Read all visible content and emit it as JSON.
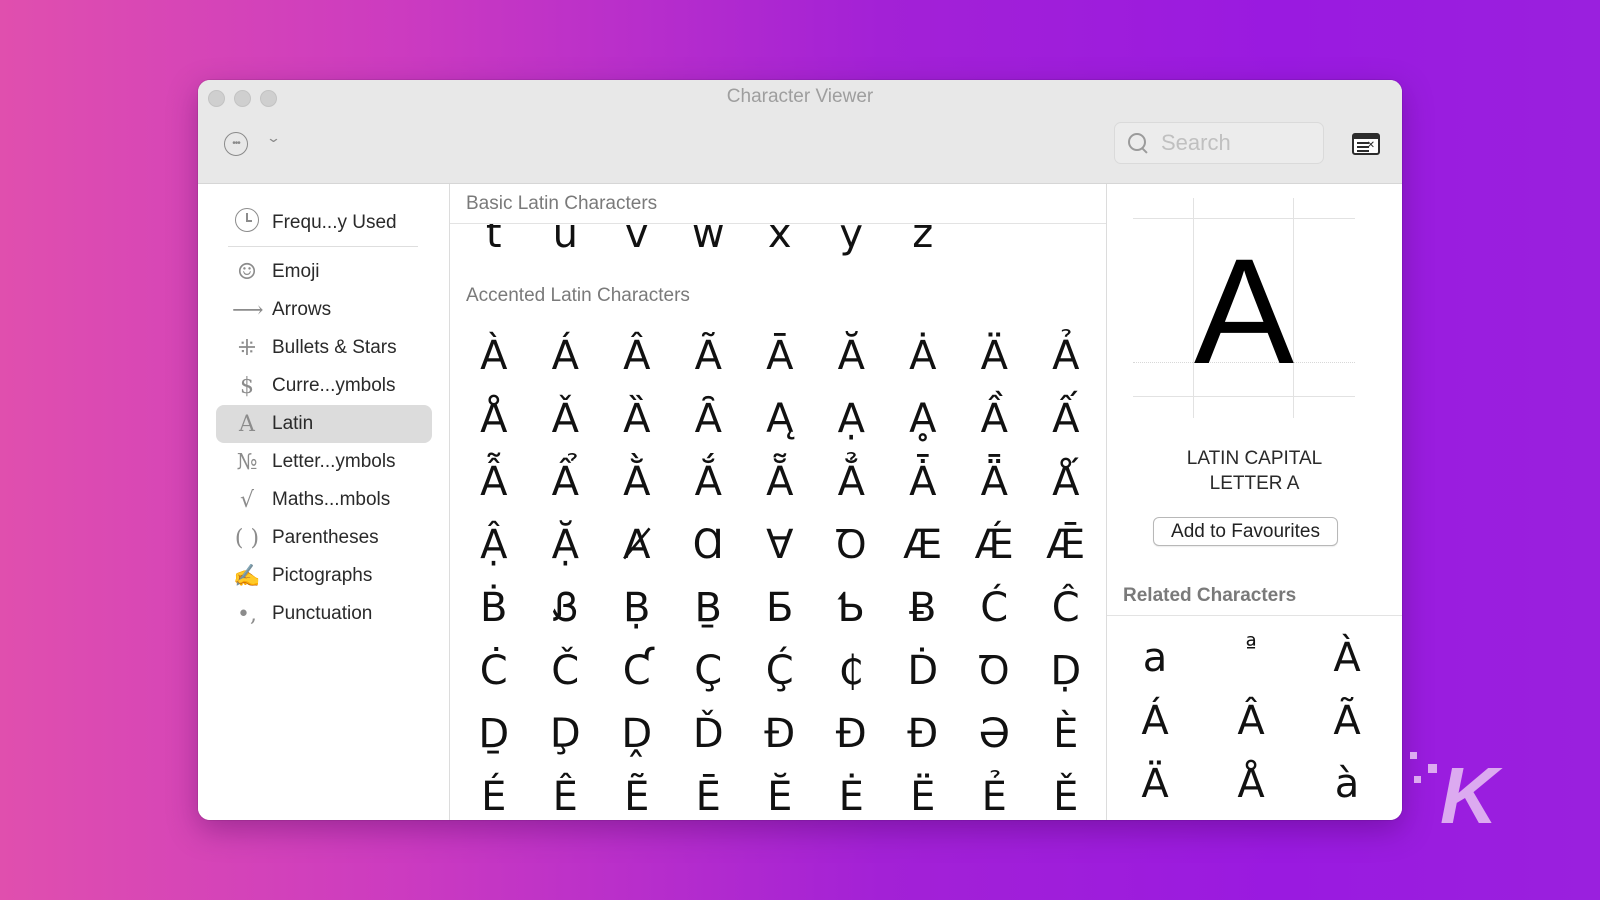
{
  "window": {
    "title": "Character Viewer",
    "traffic_lights": [
      "close",
      "minimize",
      "zoom"
    ]
  },
  "toolbar": {
    "more_icon": "ellipsis-circle-icon",
    "chevron_icon": "chevron-down-icon",
    "search_placeholder": "Search",
    "search_value": "",
    "viewer_icon": "character-viewer-window-icon"
  },
  "sidebar": {
    "items": [
      {
        "label": "Frequ...y Used",
        "icon": "clock-icon",
        "glyph": ""
      },
      {
        "label": "Emoji",
        "icon": "smiley-icon",
        "glyph": "☺"
      },
      {
        "label": "Arrows",
        "icon": "arrow-right-icon",
        "glyph": "⟶"
      },
      {
        "label": "Bullets & Stars",
        "icon": "asterisk-icon",
        "glyph": "⁜"
      },
      {
        "label": "Curre...ymbols",
        "icon": "dollar-icon",
        "glyph": "$"
      },
      {
        "label": "Latin",
        "icon": "latin-a-icon",
        "glyph": "A",
        "selected": true
      },
      {
        "label": "Letter...ymbols",
        "icon": "numero-icon",
        "glyph": "№"
      },
      {
        "label": "Maths...mbols",
        "icon": "square-root-icon",
        "glyph": "√"
      },
      {
        "label": "Parentheses",
        "icon": "parentheses-icon",
        "glyph": "( )"
      },
      {
        "label": "Pictographs",
        "icon": "pictograph-icon",
        "glyph": "✍"
      },
      {
        "label": "Punctuation",
        "icon": "punctuation-icon",
        "glyph": "•,"
      }
    ]
  },
  "main": {
    "basic_header": "Basic Latin Characters",
    "basic_chars": [
      "t",
      "u",
      "v",
      "w",
      "x",
      "y",
      "z"
    ],
    "accented_header": "Accented Latin Characters",
    "accented_chars": [
      "À",
      "Á",
      "Â",
      "Ã",
      "Ā",
      "Ă",
      "Ȧ",
      "Ä",
      "Ả",
      "Å",
      "Ǎ",
      "Ȁ",
      "Ȃ",
      "Ą",
      "Ạ",
      "Ḁ",
      "Ầ",
      "Ấ",
      "Ẫ",
      "Ẩ",
      "Ằ",
      "Ắ",
      "Ẵ",
      "Ẳ",
      "Ǡ",
      "Ǟ",
      "Ǻ",
      "Ậ",
      "Ặ",
      "Ⱥ",
      "Ɑ",
      "Ɐ",
      "Ꝺ",
      "Æ",
      "Ǽ",
      "Ǣ",
      "Ḃ",
      "Ᏸ",
      "Ḅ",
      "Ḇ",
      "Б",
      "Ƅ",
      "Ƀ",
      "Ć",
      "Ĉ",
      "Ċ",
      "Č",
      "Ƈ",
      "Ç",
      "Ḉ",
      "₵",
      "Ḋ",
      "Ꝺ",
      "Ḍ",
      "Ḏ",
      "Ḑ",
      "Ḓ",
      "Ď",
      "Đ",
      "Ɖ",
      "Ð",
      "Ə",
      "È",
      "É",
      "Ê",
      "Ẽ",
      "Ē",
      "Ĕ",
      "Ė",
      "Ë",
      "Ẻ",
      "Ě"
    ]
  },
  "inspector": {
    "preview_char": "A",
    "char_name": "LATIN CAPITAL LETTER A",
    "add_to_favourites": "Add to Favourites",
    "related_header": "Related Characters",
    "related_chars": [
      "a",
      "ª",
      "À",
      "Á",
      "Â",
      "Ã",
      "Ä",
      "Å",
      "à"
    ]
  },
  "watermark": {
    "text": "K"
  }
}
